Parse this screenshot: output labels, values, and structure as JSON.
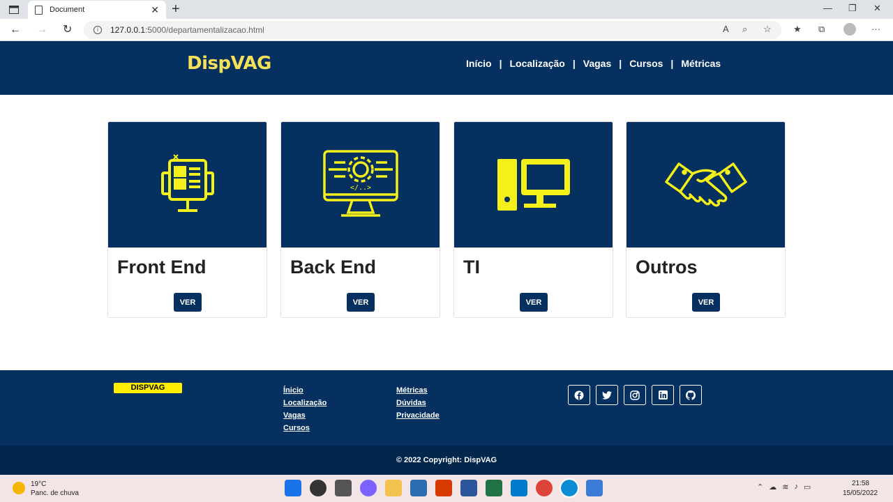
{
  "browser": {
    "tab_title": "Document",
    "close_glyph": "✕",
    "new_tab_glyph": "+",
    "url_host": "127.0.0.1",
    "url_path": ":5000/departamentalizacao.html",
    "back_glyph": "←",
    "forward_glyph": "→",
    "reload_glyph": "↻",
    "minimize_glyph": "—",
    "maximize_glyph": "❐",
    "window_close_glyph": "✕",
    "more_glyph": "···"
  },
  "site": {
    "logo": "DispVAG",
    "nav": [
      "Início",
      "Localização",
      "Vagas",
      "Cursos",
      "Métricas"
    ],
    "nav_separator": "|"
  },
  "cards": [
    {
      "title": "Front End",
      "button": "VER",
      "icon": "frontend-monitor-icon"
    },
    {
      "title": "Back End",
      "button": "VER",
      "icon": "backend-gear-monitor-icon"
    },
    {
      "title": "TI",
      "button": "VER",
      "icon": "desktop-computer-icon"
    },
    {
      "title": "Outros",
      "button": "VER",
      "icon": "handshake-icon"
    }
  ],
  "footer": {
    "brand": "DISPVAG",
    "col1": [
      "Ínicio",
      "Localização",
      "Vagas",
      "Cursos"
    ],
    "col2": [
      "Métricas",
      "Dúvidas",
      "Privacidade"
    ],
    "socials": [
      "facebook-icon",
      "twitter-icon",
      "instagram-icon",
      "linkedin-icon",
      "github-icon"
    ],
    "copyright": "© 2022 Copyright: DispVAG"
  },
  "taskbar": {
    "temperature": "19°C",
    "weather": "Panc. de chuva",
    "time": "21:58",
    "date": "15/05/2022"
  },
  "colors": {
    "navy": "#05305f",
    "icon_yellow": "#f4f01a",
    "logo_yellow": "#f5e05a",
    "brand_badge": "#ffee00"
  }
}
